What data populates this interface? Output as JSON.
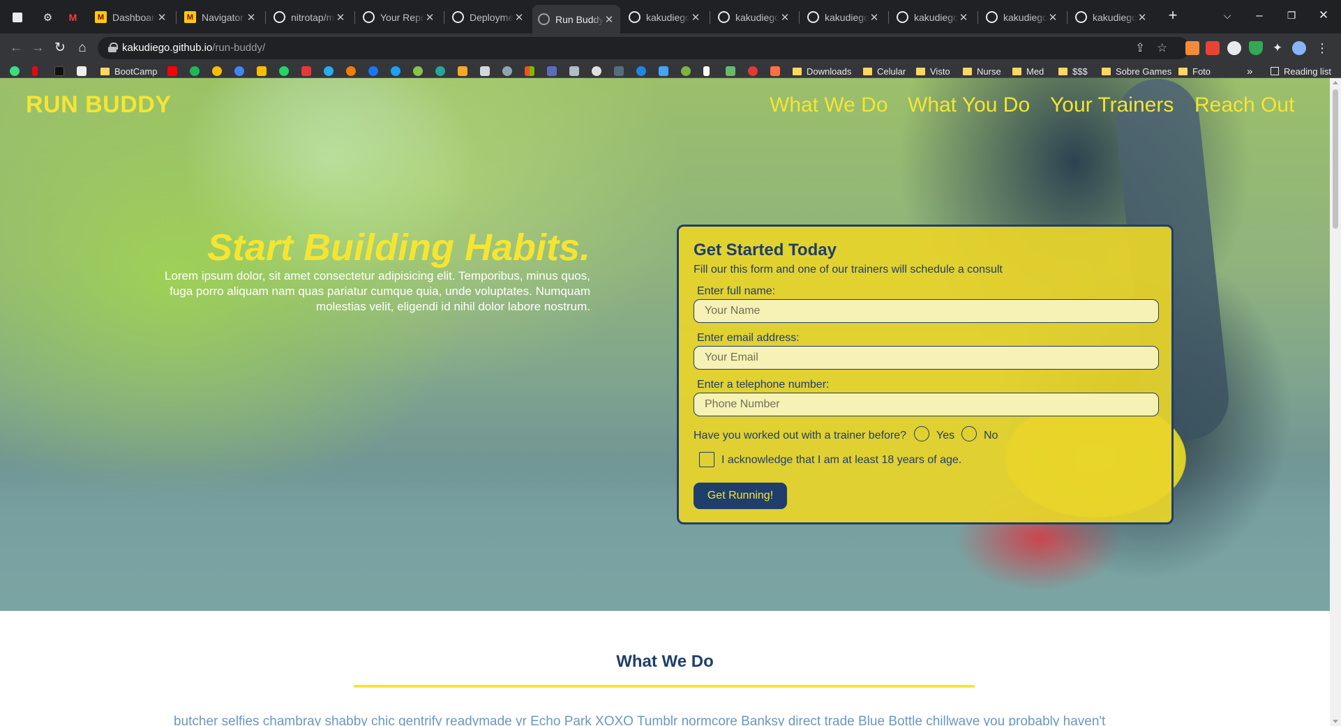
{
  "browser": {
    "tabs": [
      {
        "title": "Dashboard",
        "icon": "m-logo-icon"
      },
      {
        "title": "Navigator -",
        "icon": "m-logo-icon"
      },
      {
        "title": "nitrotap/mc",
        "icon": "github-icon"
      },
      {
        "title": "Your Reposi",
        "icon": "github-icon"
      },
      {
        "title": "Deploymen",
        "icon": "github-icon"
      },
      {
        "title": "Run Buddy",
        "icon": "globe-icon"
      },
      {
        "title": "kakudiego/",
        "icon": "github-icon"
      },
      {
        "title": "kakudiego/",
        "icon": "github-icon"
      },
      {
        "title": "kakudiego/",
        "icon": "github-icon"
      },
      {
        "title": "kakudiego/",
        "icon": "github-icon"
      },
      {
        "title": "kakudiego/",
        "icon": "github-icon"
      },
      {
        "title": "kakudiego/",
        "icon": "github-icon"
      }
    ],
    "active_tab": 5,
    "url_host": "kakudiego.github.io",
    "url_path": "/run-buddy/",
    "bookmarks": [
      {
        "label": "BootCamp",
        "type": "folder"
      },
      {
        "label": "Downloads",
        "type": "folder"
      },
      {
        "label": "Celular",
        "type": "folder"
      },
      {
        "label": "Visto",
        "type": "folder"
      },
      {
        "label": "Nurse",
        "type": "folder"
      },
      {
        "label": "Med",
        "type": "folder"
      },
      {
        "label": "$$$",
        "type": "folder"
      },
      {
        "label": "Sobre Games",
        "type": "folder"
      },
      {
        "label": "Foto",
        "type": "folder"
      }
    ],
    "overflow": "»",
    "reading_list": "Reading list"
  },
  "page": {
    "logo": "RUN BUDDY",
    "nav": [
      "What We Do",
      "What You Do",
      "Your Trainers",
      "Reach Out"
    ],
    "hero": {
      "title": "Start Building Habits.",
      "text": "Lorem ipsum dolor, sit amet consectetur adipisicing elit. Temporibus, minus quos, fuga porro aliquam nam quas pariatur cumque quia, unde voluptates. Numquam molestias velit, eligendi id nihil dolor labore nostrum."
    },
    "form": {
      "title": "Get Started Today",
      "subtitle": "Fill our this form and one of our trainers will schedule a consult",
      "name_label": "Enter full name:",
      "name_placeholder": "Your Name",
      "email_label": "Enter email address:",
      "email_placeholder": "Your Email",
      "phone_label": "Enter a telephone number:",
      "phone_placeholder": "Phone Number",
      "question": "Have you worked out with a trainer before?",
      "option_yes": "Yes",
      "option_no": "No",
      "ack": "I acknowledge that I am at least 18 years of age.",
      "submit": "Get Running!"
    },
    "section": {
      "title": "What We Do",
      "text": "butcher selfies chambray shabby chic gentrify readymade yr Echo Park XOXO Tumblr normcore Banksy direct trade Blue Bottle chillwave you probably haven't"
    }
  },
  "colors": {
    "brand_yellow": "#f5e533",
    "brand_navy": "#1f3e6b",
    "link_blue": "#6a97bf"
  }
}
